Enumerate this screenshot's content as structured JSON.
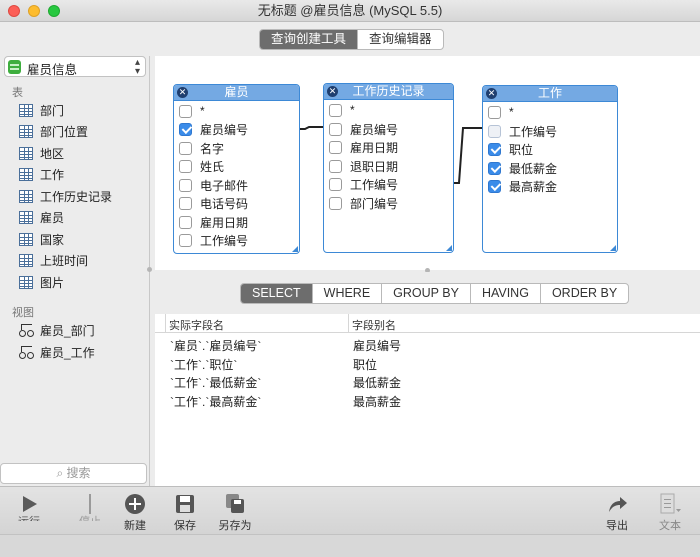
{
  "window": {
    "title": "无标题 @雇员信息 (MySQL 5.5)"
  },
  "top_tabs": [
    {
      "label": "查询创建工具",
      "active": true
    },
    {
      "label": "查询编辑器",
      "active": false
    }
  ],
  "sidebar": {
    "database": "雇员信息",
    "tables_title": "表",
    "tables": [
      "部门",
      "部门位置",
      "地区",
      "工作",
      "工作历史记录",
      "雇员",
      "国家",
      "上班时间",
      "图片"
    ],
    "views_title": "视图",
    "views": [
      "雇员_部门",
      "雇员_工作"
    ],
    "search_placeholder": "搜索"
  },
  "diagram": {
    "tables": [
      {
        "name": "雇员",
        "fields": [
          {
            "label": "*",
            "checked": false
          },
          {
            "label": "雇员编号",
            "checked": true
          },
          {
            "label": "名字",
            "checked": false
          },
          {
            "label": "姓氏",
            "checked": false
          },
          {
            "label": "电子邮件",
            "checked": false
          },
          {
            "label": "电话号码",
            "checked": false
          },
          {
            "label": "雇用日期",
            "checked": false
          },
          {
            "label": "工作编号",
            "checked": false
          }
        ]
      },
      {
        "name": "工作历史记录",
        "fields": [
          {
            "label": "*",
            "checked": false
          },
          {
            "label": "雇员编号",
            "checked": false
          },
          {
            "label": "雇用日期",
            "checked": false
          },
          {
            "label": "退职日期",
            "checked": false
          },
          {
            "label": "工作编号",
            "checked": false
          },
          {
            "label": "部门编号",
            "checked": false
          }
        ]
      },
      {
        "name": "工作",
        "fields": [
          {
            "label": "*",
            "checked": false
          },
          {
            "label": "工作编号",
            "checked": false
          },
          {
            "label": "职位",
            "checked": true
          },
          {
            "label": "最低薪金",
            "checked": true
          },
          {
            "label": "最高薪金",
            "checked": true
          }
        ]
      }
    ]
  },
  "clause_tabs": [
    {
      "label": "SELECT",
      "active": true
    },
    {
      "label": "WHERE",
      "active": false
    },
    {
      "label": "GROUP BY",
      "active": false
    },
    {
      "label": "HAVING",
      "active": false
    },
    {
      "label": "ORDER BY",
      "active": false
    }
  ],
  "grid": {
    "columns": [
      "实际字段名",
      "字段别名"
    ],
    "rows": [
      [
        "`雇员`.`雇员编号`",
        "雇员编号"
      ],
      [
        "`工作`.`职位`",
        "职位"
      ],
      [
        "`工作`.`最低薪金`",
        "最低薪金"
      ],
      [
        "`工作`.`最高薪金`",
        "最高薪金"
      ]
    ]
  },
  "toolbar": {
    "run_label": "运行",
    "stop_label": "停止",
    "new_label": "新建",
    "save_label": "保存",
    "save_as_label": "另存为",
    "export_label": "导出",
    "text_label": "文本"
  }
}
